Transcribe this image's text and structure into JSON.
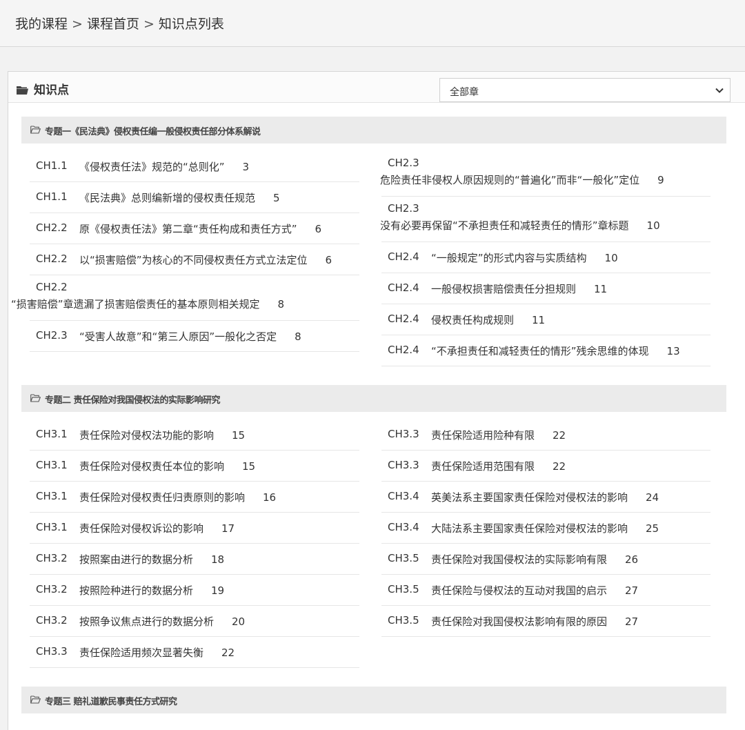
{
  "breadcrumb": {
    "items": [
      "我的课程",
      "课程首页",
      "知识点列表"
    ],
    "separator": ">"
  },
  "panel": {
    "title": "知识点",
    "chapter_select": {
      "selected": "全部章"
    }
  },
  "colors": {
    "accent": "#333333",
    "topic_bg": "#ebebeb",
    "border": "#e6e6e6"
  },
  "topics": [
    {
      "title": "专题一《民法典》侵权责任编一般侵权责任部分体系解说",
      "left": [
        {
          "ch": "CH1.1",
          "title": "《侵权责任法》规范的“总则化”",
          "page": "3"
        },
        {
          "ch": "CH1.1",
          "title": "《民法典》总则编新增的侵权责任规范",
          "page": "5"
        },
        {
          "ch": "CH2.2",
          "title": "原《侵权责任法》第二章“责任构成和责任方式”",
          "page": "6"
        },
        {
          "ch": "CH2.2",
          "title": "以“损害赔偿”为核心的不同侵权责任方式立法定位",
          "page": "6"
        },
        {
          "ch": "CH2.2",
          "title": "“损害赔偿”章遗漏了损害赔偿责任的基本原则相关规定",
          "page": "8"
        },
        {
          "ch": "CH2.3",
          "title": "“受害人故意”和“第三人原因”一般化之否定",
          "page": "8"
        }
      ],
      "right": [
        {
          "ch": "CH2.3",
          "title": "危险责任非侵权人原因规则的“普遍化”而非“一般化”定位",
          "page": "9"
        },
        {
          "ch": "CH2.3",
          "title": "没有必要再保留“不承担责任和减轻责任的情形”章标题",
          "page": "10"
        },
        {
          "ch": "CH2.4",
          "title": "“一般规定”的形式内容与实质结构",
          "page": "10"
        },
        {
          "ch": "CH2.4",
          "title": "一般侵权损害赔偿责任分担规则",
          "page": "11"
        },
        {
          "ch": "CH2.4",
          "title": "侵权责任构成规则",
          "page": "11"
        },
        {
          "ch": "CH2.4",
          "title": "“不承担责任和减轻责任的情形”残余思维的体现",
          "page": "13"
        }
      ]
    },
    {
      "title": "专题二 责任保险对我国侵权法的实际影响研究",
      "left": [
        {
          "ch": "CH3.1",
          "title": "责任保险对侵权法功能的影响",
          "page": "15"
        },
        {
          "ch": "CH3.1",
          "title": "责任保险对侵权责任本位的影响",
          "page": "15"
        },
        {
          "ch": "CH3.1",
          "title": "责任保险对侵权责任归责原则的影响",
          "page": "16"
        },
        {
          "ch": "CH3.1",
          "title": "责任保险对侵权诉讼的影响",
          "page": "17"
        },
        {
          "ch": "CH3.2",
          "title": "按照案由进行的数据分析",
          "page": "18"
        },
        {
          "ch": "CH3.2",
          "title": "按照险种进行的数据分析",
          "page": "19"
        },
        {
          "ch": "CH3.2",
          "title": "按照争议焦点进行的数据分析",
          "page": "20"
        },
        {
          "ch": "CH3.3",
          "title": "责任保险适用频次显著失衡",
          "page": "22"
        }
      ],
      "right": [
        {
          "ch": "CH3.3",
          "title": "责任保险适用险种有限",
          "page": "22"
        },
        {
          "ch": "CH3.3",
          "title": "责任保险适用范围有限",
          "page": "22"
        },
        {
          "ch": "CH3.4",
          "title": "英美法系主要国家责任保险对侵权法的影响",
          "page": "24"
        },
        {
          "ch": "CH3.4",
          "title": "大陆法系主要国家责任保险对侵权法的影响",
          "page": "25"
        },
        {
          "ch": "CH3.5",
          "title": "责任保险对我国侵权法的实际影响有限",
          "page": "26"
        },
        {
          "ch": "CH3.5",
          "title": "责任保险与侵权法的互动对我国的启示",
          "page": "27"
        },
        {
          "ch": "CH3.5",
          "title": "责任保险对我国侵权法影响有限的原因",
          "page": "27"
        }
      ]
    },
    {
      "title": "专题三 赔礼道歉民事责任方式研究",
      "left": [],
      "right": []
    }
  ]
}
